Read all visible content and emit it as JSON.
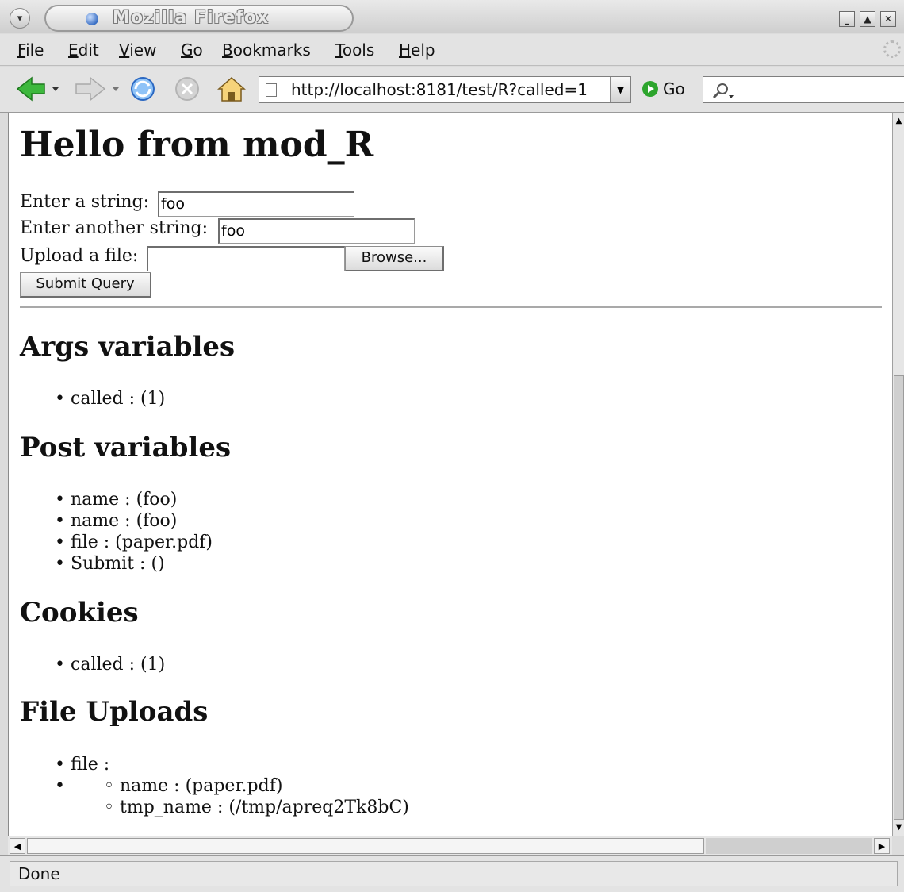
{
  "window": {
    "title": "Mozilla Firefox"
  },
  "menu": {
    "items": [
      {
        "label": "File",
        "mnemonic": "F"
      },
      {
        "label": "Edit",
        "mnemonic": "E"
      },
      {
        "label": "View",
        "mnemonic": "V"
      },
      {
        "label": "Go",
        "mnemonic": "G"
      },
      {
        "label": "Bookmarks",
        "mnemonic": "B"
      },
      {
        "label": "Tools",
        "mnemonic": "T"
      },
      {
        "label": "Help",
        "mnemonic": "H"
      }
    ]
  },
  "toolbar": {
    "url": "http://localhost:8181/test/R?called=1",
    "go_label": "Go",
    "search_value": ""
  },
  "page": {
    "heading": "Hello from mod_R",
    "form": {
      "string_label": "Enter a string:",
      "string_value": "foo",
      "another_label": "Enter another string:",
      "another_value": "foo",
      "upload_label": "Upload a file:",
      "upload_value": "",
      "browse_label": "Browse...",
      "submit_label": "Submit Query"
    },
    "sections": {
      "args": {
        "title": "Args variables",
        "items": [
          "called : (1)"
        ]
      },
      "post": {
        "title": "Post variables",
        "items": [
          "name : (foo)",
          "name : (foo)",
          "file : (paper.pdf)",
          "Submit : ()"
        ]
      },
      "cookies": {
        "title": "Cookies",
        "items": [
          "called : (1)"
        ]
      },
      "uploads": {
        "title": "File Uploads",
        "item": "file :",
        "sub_items": [
          "name : (paper.pdf)",
          "tmp_name : (/tmp/apreq2Tk8bC)"
        ]
      }
    }
  },
  "status": {
    "text": "Done"
  },
  "colors": {
    "chrome_bg": "#e3e3e3",
    "back_arrow": "#3db83d",
    "go_green": "#2da52d",
    "reload_blue": "#3a7bd5"
  }
}
